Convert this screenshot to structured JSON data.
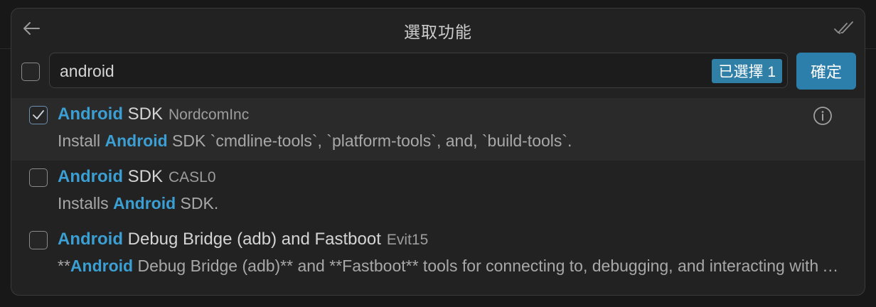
{
  "dialog": {
    "title": "選取功能",
    "icons": {
      "back": "arrow-left-icon",
      "ok_all": "check-all-icon",
      "info": "info-icon",
      "check": "check-icon"
    }
  },
  "search": {
    "value": "android",
    "selected_badge": "已選擇 1",
    "ok_label": "確定"
  },
  "items": [
    {
      "checked": true,
      "title_highlight": "Android",
      "title_rest": " SDK",
      "publisher": "NordcomInc",
      "desc_before": "Install ",
      "desc_highlight": "Android",
      "desc_after": " SDK `cmdline-tools`, `platform-tools`, and, `build-tools`."
    },
    {
      "checked": false,
      "title_highlight": "Android",
      "title_rest": " SDK",
      "publisher": "CASL0",
      "desc_before": "Installs ",
      "desc_highlight": "Android",
      "desc_after": " SDK."
    },
    {
      "checked": false,
      "title_highlight": "Android",
      "title_rest": " Debug Bridge (adb) and Fastboot",
      "publisher": "Evit15",
      "desc_before": "**",
      "desc_highlight": "Android",
      "desc_after": " Debug Bridge (adb)** and **Fastboot** tools for connecting to, debugging, and interacting with Android devices."
    }
  ],
  "colors": {
    "highlight": "#3b9fd3",
    "primary_button": "#2d7fab",
    "badge": "#2f7fa6"
  }
}
